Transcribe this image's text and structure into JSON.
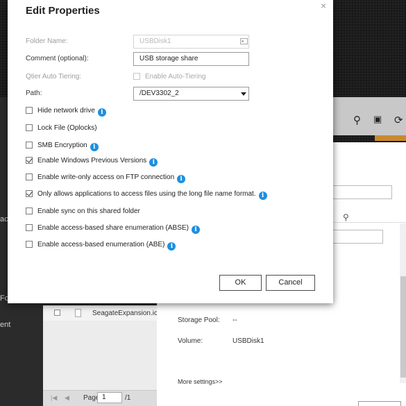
{
  "dialog": {
    "title": "Edit Properties",
    "close_symbol": "×",
    "fields": {
      "folder_name": {
        "label": "Folder Name:",
        "value": "USBDisk1"
      },
      "comment": {
        "label": "Comment (optional):",
        "value": "USB storage share"
      },
      "qtier": {
        "label": "Qtier Auto Tiering:",
        "option": "Enable Auto-Tiering"
      },
      "path": {
        "label": "Path:",
        "value": "/DEV3302_2"
      }
    },
    "options": [
      {
        "label": "Hide network drive",
        "checked": false,
        "info": true
      },
      {
        "label": "Lock File (Oplocks)",
        "checked": false,
        "info": false
      },
      {
        "label": "SMB Encryption",
        "checked": false,
        "info": true
      },
      {
        "label": "Enable Windows Previous Versions",
        "checked": true,
        "info": true
      },
      {
        "label": "Enable write-only access on FTP connection",
        "checked": false,
        "info": true
      },
      {
        "label": "Only allows applications to access files using the long file name format.",
        "checked": true,
        "info": true
      },
      {
        "label": "Enable sync on this shared folder",
        "checked": false,
        "info": false
      },
      {
        "label": "Enable access-based share enumeration (ABSE)",
        "checked": false,
        "info": true
      },
      {
        "label": "Enable access-based enumeration (ABE)",
        "checked": false,
        "info": true
      }
    ],
    "info_glyph": "i",
    "ok_label": "OK",
    "cancel_label": "Cancel"
  },
  "background": {
    "sidebar_fragments": [
      "ac",
      "Fo",
      "ent"
    ],
    "list_item": "SeagateExpansion.ico",
    "pager": {
      "label": "Page",
      "page": "1",
      "total": "/1"
    },
    "details": {
      "storage_pool_label": "Storage Pool:",
      "storage_pool_value": "--",
      "volume_label": "Volume:",
      "volume_value": "USBDisk1",
      "more_settings": "More settings>>"
    }
  },
  "colors": {
    "info_blue": "#1e8fdf",
    "accent_orange": "#c98a2e"
  }
}
